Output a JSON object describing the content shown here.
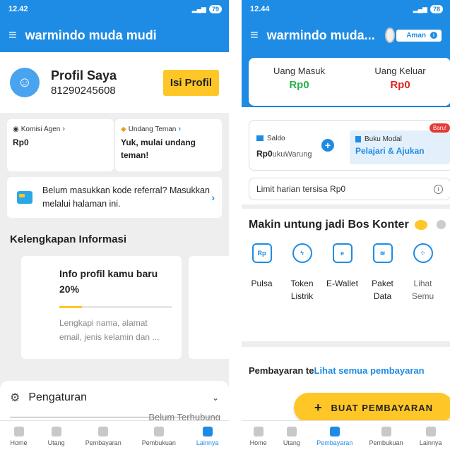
{
  "colors": {
    "brand_blue": "#1e8ce4",
    "accent_yellow": "#ffc627",
    "money_in": "#25b34b",
    "money_out": "#e02424"
  },
  "left": {
    "status": {
      "time": "12.42",
      "battery": "79"
    },
    "appbar": {
      "menu_icon": "hamburger-icon",
      "title": "warmindo muda mudi"
    },
    "profile": {
      "name": "Profil Saya",
      "phone": "81290245608",
      "button": "Isi Profil"
    },
    "komisi": {
      "label": "Komisi Agen",
      "value": "Rp0"
    },
    "undang": {
      "label": "Undang Teman",
      "value": "Yuk, mulai undang teman!"
    },
    "referral": {
      "text": "Belum masukkan kode referral? Masukkan melalui halaman ini."
    },
    "kelengkapan": {
      "title": "Kelengkapan Informasi"
    },
    "info_card": {
      "title": "Info profil kamu baru 20%",
      "progress": 0.2,
      "desc": "Lengkapi nama, alamat email, jenis kelamin dan ..."
    },
    "settings": {
      "label": "Pengaturan",
      "status": "Belum Terhubung"
    },
    "nav": [
      {
        "label": "Home"
      },
      {
        "label": "Utang"
      },
      {
        "label": "Pembayaran"
      },
      {
        "label": "Pembukuan"
      },
      {
        "label": "Lainnya",
        "active": true
      }
    ]
  },
  "right": {
    "status": {
      "time": "12.44",
      "battery": "78"
    },
    "appbar": {
      "title": "warmindo muda...",
      "badge": "Aman"
    },
    "money": {
      "in_label": "Uang Masuk",
      "in_value": "Rp0",
      "out_label": "Uang Keluar",
      "out_value": "Rp0"
    },
    "saldo": {
      "label": "Saldo",
      "value_bold": "Rp0",
      "value_rest": "ukuWarung"
    },
    "modal": {
      "label": "Buku Modal",
      "value": "Pelajari & Ajukan",
      "badge": "Baru!"
    },
    "limit": {
      "text": "Limit harian tersisa Rp0"
    },
    "promo": {
      "title": "Makin untung jadi Bos Konter"
    },
    "services": [
      {
        "label": "Pulsa",
        "icon": "phone-rp-icon"
      },
      {
        "label": "Token Listrik",
        "icon": "lightning-icon"
      },
      {
        "label": "E-Wallet",
        "icon": "wallet-icon"
      },
      {
        "label": "Paket Data",
        "icon": "wifi-phone-icon"
      },
      {
        "label": "Lihat Semu",
        "icon": "grid-icon"
      }
    ],
    "payment": {
      "text": "Pembayaran te",
      "link": "Lihat semua pembayaran"
    },
    "buat_button": "BUAT PEMBAYARAN",
    "nav": [
      {
        "label": "Home"
      },
      {
        "label": "Utang"
      },
      {
        "label": "Pembayaran",
        "active": true
      },
      {
        "label": "Pembukuan"
      },
      {
        "label": "Lainnya"
      }
    ]
  }
}
